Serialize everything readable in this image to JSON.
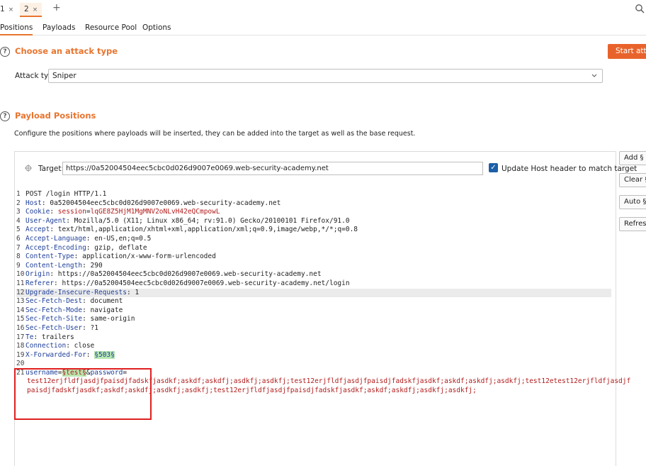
{
  "tabs": [
    {
      "label": "1",
      "close": "×"
    },
    {
      "label": "2",
      "close": "×"
    }
  ],
  "new_tab": "+",
  "subtabs": [
    "Positions",
    "Payloads",
    "Resource Pool",
    "Options"
  ],
  "attack_section": {
    "help": "?",
    "title": "Choose an attack type",
    "start_button": "Start attack",
    "attack_type_label": "Attack type:",
    "attack_type_value": "Sniper"
  },
  "payload_section": {
    "help": "?",
    "title": "Payload Positions",
    "description": "Configure the positions where payloads will be inserted, they can be added into the target as well as the base request.",
    "target_label": "Target:",
    "target_value": "https://0a52004504eec5cbc0d026d9007e0069.web-security-academy.net",
    "update_host_label": "Update Host header to match target",
    "update_host_checked": true
  },
  "side_buttons": [
    "Add §",
    "Clear §",
    "Auto §",
    "Refresh"
  ],
  "request": {
    "l1": {
      "n": "1",
      "text": "POST /login HTTP/1.1"
    },
    "l2": {
      "n": "2",
      "k": "Host",
      "v": "0a52004504eec5cbc0d026d9007e0069.web-security-academy.net"
    },
    "l3": {
      "n": "3",
      "k": "Cookie",
      "ck": "session",
      "cv": "lqGE8Z5HjM1MgMNV2oNLvH42eQCmpowL"
    },
    "l4": {
      "n": "4",
      "k": "User-Agent",
      "v": "Mozilla/5.0 (X11; Linux x86_64; rv:91.0) Gecko/20100101 Firefox/91.0"
    },
    "l5": {
      "n": "5",
      "k": "Accept",
      "v": "text/html,application/xhtml+xml,application/xml;q=0.9,image/webp,*/*;q=0.8"
    },
    "l6": {
      "n": "6",
      "k": "Accept-Language",
      "v": "en-US,en;q=0.5"
    },
    "l7": {
      "n": "7",
      "k": "Accept-Encoding",
      "v": "gzip, deflate"
    },
    "l8": {
      "n": "8",
      "k": "Content-Type",
      "v": "application/x-www-form-urlencoded"
    },
    "l9": {
      "n": "9",
      "k": "Content-Length",
      "v": "290"
    },
    "l10": {
      "n": "10",
      "k": "Origin",
      "v": "https://0a52004504eec5cbc0d026d9007e0069.web-security-academy.net"
    },
    "l11": {
      "n": "11",
      "k": "Referer",
      "v": "https://0a52004504eec5cbc0d026d9007e0069.web-security-academy.net/login"
    },
    "l12": {
      "n": "12",
      "k": "Upgrade-Insecure-Requests",
      "v": "1"
    },
    "l13": {
      "n": "13",
      "k": "Sec-Fetch-Dest",
      "v": "document"
    },
    "l14": {
      "n": "14",
      "k": "Sec-Fetch-Mode",
      "v": "navigate"
    },
    "l15": {
      "n": "15",
      "k": "Sec-Fetch-Site",
      "v": "same-origin"
    },
    "l16": {
      "n": "16",
      "k": "Sec-Fetch-User",
      "v": "?1"
    },
    "l17": {
      "n": "17",
      "k": "Te",
      "v": "trailers"
    },
    "l18": {
      "n": "18",
      "k": "Connection",
      "v": "close"
    },
    "l19": {
      "n": "19",
      "k": "X-Forwarded-For",
      "p": "§503§"
    },
    "l20": {
      "n": "20"
    },
    "l21": {
      "n": "21",
      "k1": "username",
      "p1": "§test§",
      "amp": "&",
      "k2": "password",
      "eq": "="
    },
    "body_cont1": "test12erjfldfjasdjfpaisdjfadskfjasdkf;askdf;askdfj;asdkfj;asdkfj;test12erjfldfjasdjfpaisdjfadskfjasdkf;askdf;askdfj;asdkfj;test12etest12erjfldfjasdjf",
    "body_cont2": "paisdjfadskfjasdkf;askdf;askdfj;asdkfj;asdkfj;test12erjfldfjasdjfpaisdjfadskfjasdkf;askdf;askdfj;asdkfj;asdkfj;"
  }
}
